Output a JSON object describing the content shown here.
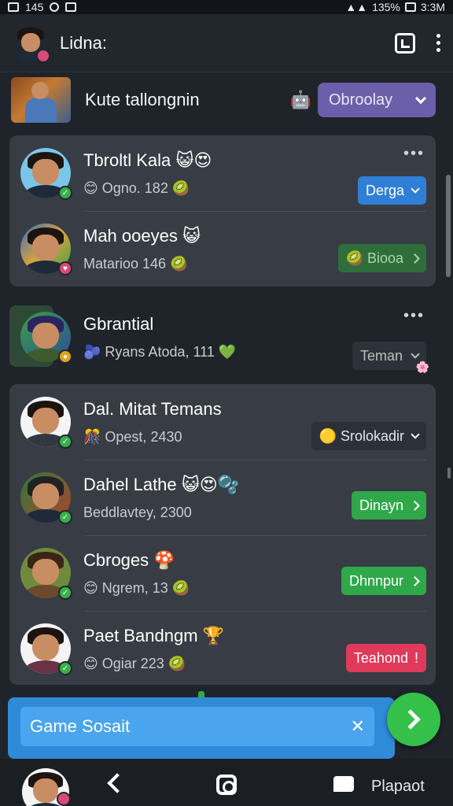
{
  "status_bar": {
    "time_left": "145",
    "battery": "135%",
    "clock": "3:3M"
  },
  "header": {
    "title": "Lidna:",
    "icons": [
      "profile-avatar",
      "window-icon",
      "more-icon"
    ]
  },
  "featured": {
    "name": "Kute tallongnin",
    "emoji": "🤖",
    "dropdown_label": "Obroolay"
  },
  "card1": {
    "more": "•••",
    "rows": [
      {
        "name": "Tbroltl Kala 😺😍",
        "sub": "😊 Ogno. 182 🥝",
        "button": "Derga"
      },
      {
        "name": "Mah ooeyes 😺",
        "sub": "Matarioo 146 🥝",
        "button": "🥝 Biooa"
      }
    ]
  },
  "standalone": {
    "more": "•••",
    "name": "Gbrantial",
    "sub": "🫐 Ryans Atoda, 111 💚",
    "button": "Teman",
    "emoji": "🌸"
  },
  "card2": {
    "rows": [
      {
        "name": "Dal. Mitat Temans",
        "sub": "🎊 Opest, 2430",
        "button": "🟡 Srolokadir"
      },
      {
        "name": "Dahel Lathe 😺😍🫧",
        "sub": "Beddlavtey, 2300",
        "button": "Dinayn"
      },
      {
        "name": "Cbroges 🍄",
        "sub": "😊 Ngrem, 13 🥝",
        "button": "Dhnnpur"
      },
      {
        "name": "Paet Bandngm 🏆",
        "sub": "😊 Ogiar 223 🥝",
        "button": "Teahond"
      }
    ]
  },
  "search": {
    "value": "Game Sosait",
    "clear_icon": "✕"
  },
  "bottom_nav": {
    "label": "Plapaot"
  }
}
